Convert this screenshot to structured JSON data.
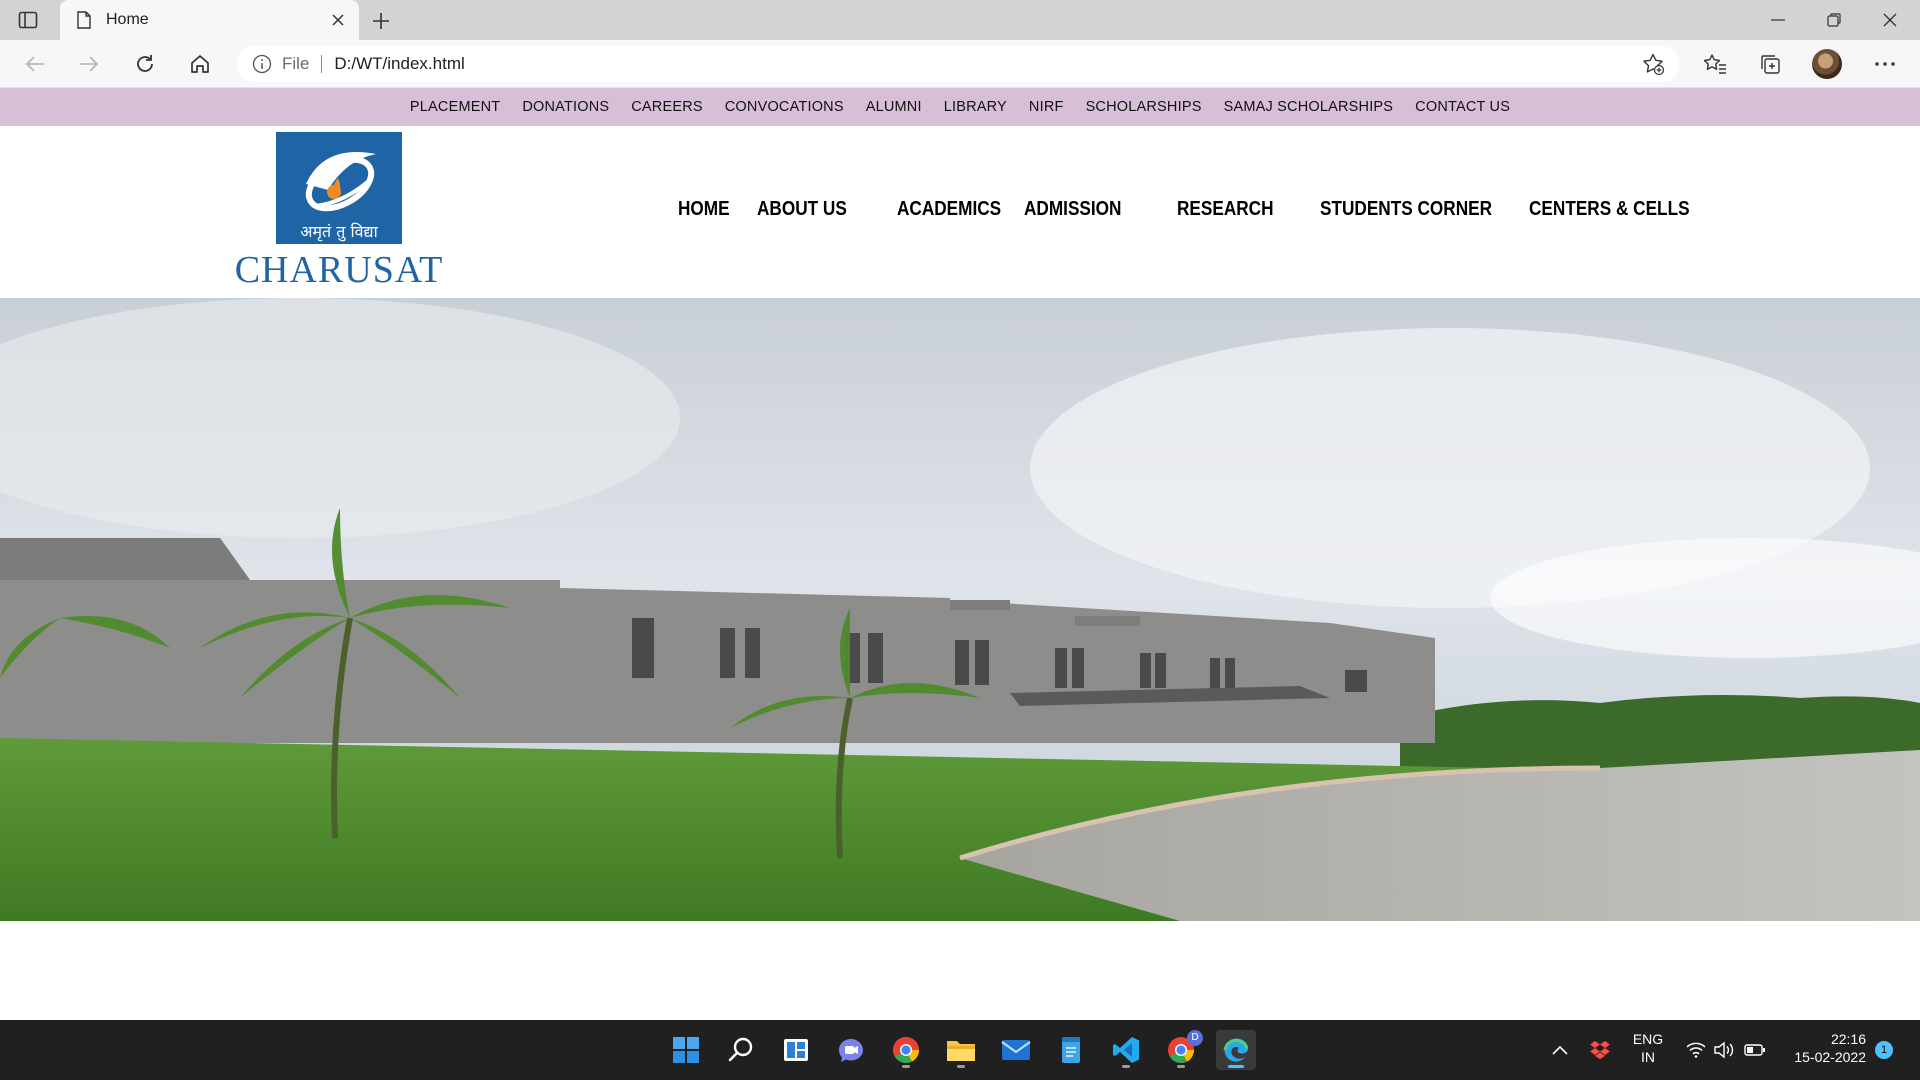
{
  "browser": {
    "tab_title": "Home",
    "address_scheme": "File",
    "address_url": "D:/WT/index.html"
  },
  "top_nav": {
    "items": [
      "PLACEMENT",
      "DONATIONS",
      "CAREERS",
      "CONVOCATIONS",
      "ALUMNI",
      "LIBRARY",
      "NIRF",
      "SCHOLARSHIPS",
      "SAMAJ SCHOLARSHIPS",
      "CONTACT US"
    ],
    "background_color": "#d8bfd8"
  },
  "logo": {
    "motto": "अमृतं तु विद्या",
    "wordmark": "CHARUSAT",
    "brand_color": "#1f65a6"
  },
  "main_nav": {
    "items": [
      "HOME",
      "ABOUT US",
      "ACADEMICS",
      "ADMISSION",
      "RESEARCH",
      "STUDENTS CORNER",
      "CENTERS & CELLS"
    ]
  },
  "taskbar": {
    "apps": [
      "start-icon",
      "search-icon",
      "widgets-icon",
      "teams-chat-icon",
      "chrome-icon",
      "file-explorer-icon",
      "mail-icon",
      "notepad-icon",
      "vscode-icon",
      "chrome-profile-icon",
      "edge-icon"
    ],
    "language": "ENG",
    "region": "IN",
    "time": "22:16",
    "date": "15-02-2022",
    "notification_count": "1",
    "chrome_profile_badge": "D"
  }
}
